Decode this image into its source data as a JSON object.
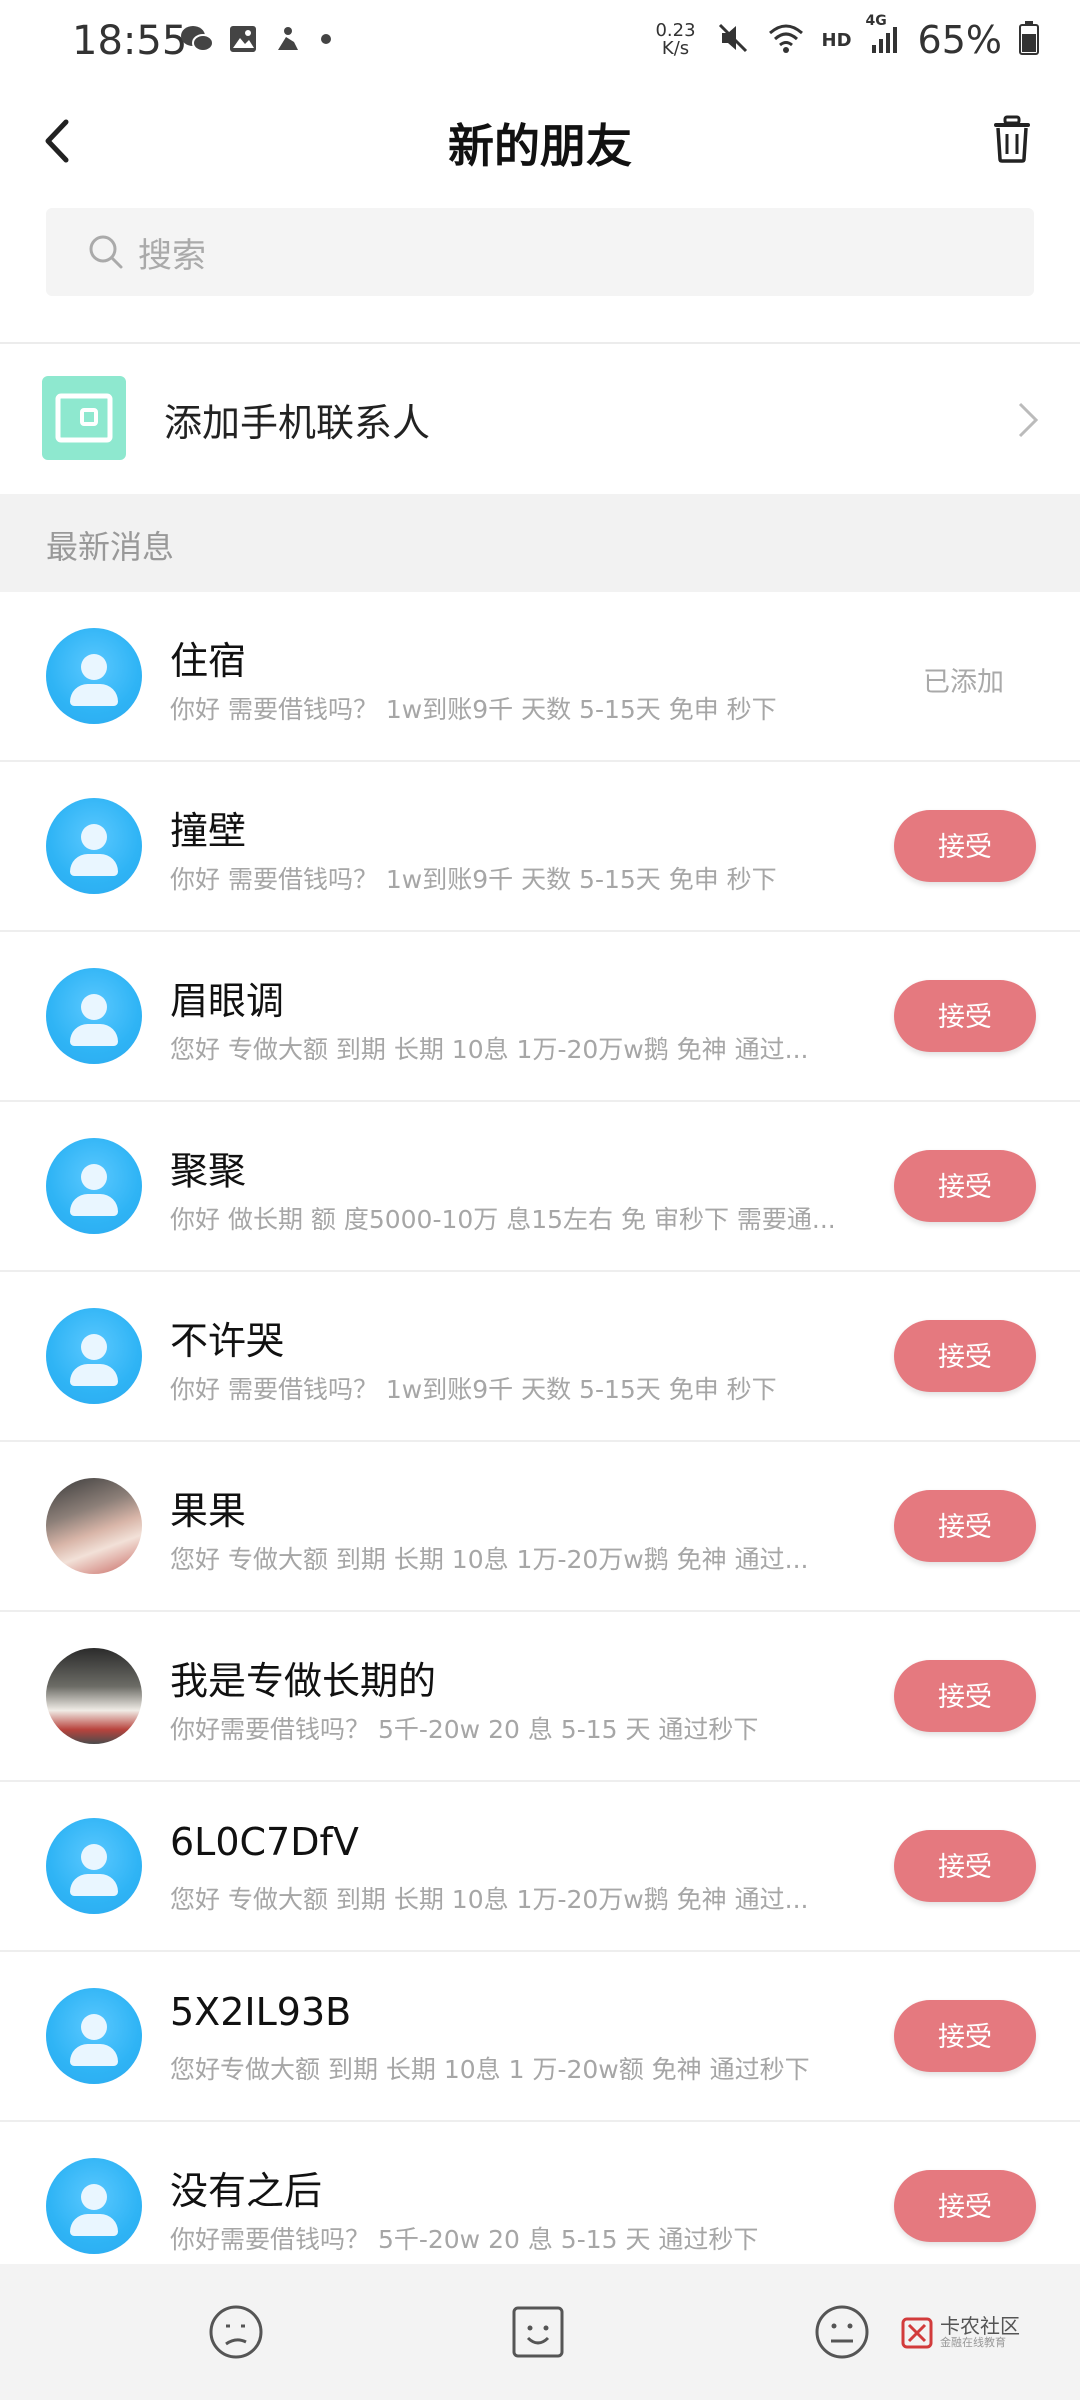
{
  "status_bar": {
    "time": "18:55",
    "net_speed_value": "0.23",
    "net_speed_unit": "K/s",
    "hd": "HD",
    "network": "4G",
    "battery": "65%"
  },
  "header": {
    "title": "新的朋友"
  },
  "search": {
    "placeholder": "搜索"
  },
  "add_contacts": {
    "label": "添加手机联系人"
  },
  "section": {
    "label": "最新消息"
  },
  "colors": {
    "accept_button": "#e5797f",
    "avatar_blue": "#2fb4f5",
    "add_icon_bg": "#8ee8cf"
  },
  "requests": [
    {
      "name": "住宿",
      "message": "你好  需要借钱吗？ 1w到账9千 天数 5-15天 免申 秒下",
      "status": "已添加",
      "avatar": "default"
    },
    {
      "name": "撞壁",
      "message": "你好  需要借钱吗？ 1w到账9千 天数 5-15天 免申 秒下",
      "status": "接受",
      "avatar": "default"
    },
    {
      "name": "眉眼调",
      "message": "您好 专做大额  到期 长期 10息  1万-20万w鹅     免神  通过...",
      "status": "接受",
      "avatar": "default"
    },
    {
      "name": "聚聚",
      "message": "你好 做长期  额 度5000-10万 息15左右 免 审秒下  需要通...",
      "status": "接受",
      "avatar": "default"
    },
    {
      "name": "不许哭",
      "message": "你好  需要借钱吗？ 1w到账9千 天数 5-15天 免申 秒下",
      "status": "接受",
      "avatar": "default"
    },
    {
      "name": "果果",
      "message": "您好 专做大额  到期 长期 10息  1万-20万w鹅     免神  通过...",
      "status": "接受",
      "avatar": "photo1"
    },
    {
      "name": "我是专做长期的",
      "message": "你好需要借钱吗？ 5千-20w 20 息 5-15 天 通过秒下",
      "status": "接受",
      "avatar": "photo2"
    },
    {
      "name": "6L0C7DfV",
      "message": "您好 专做大额  到期 长期 10息  1万-20万w鹅     免神  通过...",
      "status": "接受",
      "avatar": "default"
    },
    {
      "name": "5X2IL93B",
      "message": "您好专做大额 到期 长期 10息 1 万-20w额  免神 通过秒下",
      "status": "接受",
      "avatar": "default"
    },
    {
      "name": "没有之后",
      "message": "你好需要借钱吗？ 5千-20w 20 息 5-15 天 通过秒下",
      "status": "接受",
      "avatar": "default"
    }
  ],
  "watermark": {
    "title": "卡农社区",
    "subtitle": "金融在线教育"
  },
  "bottom_bar": {
    "icons": [
      "sad-face-icon",
      "smile-face-icon",
      "dizzy-face-icon"
    ]
  }
}
